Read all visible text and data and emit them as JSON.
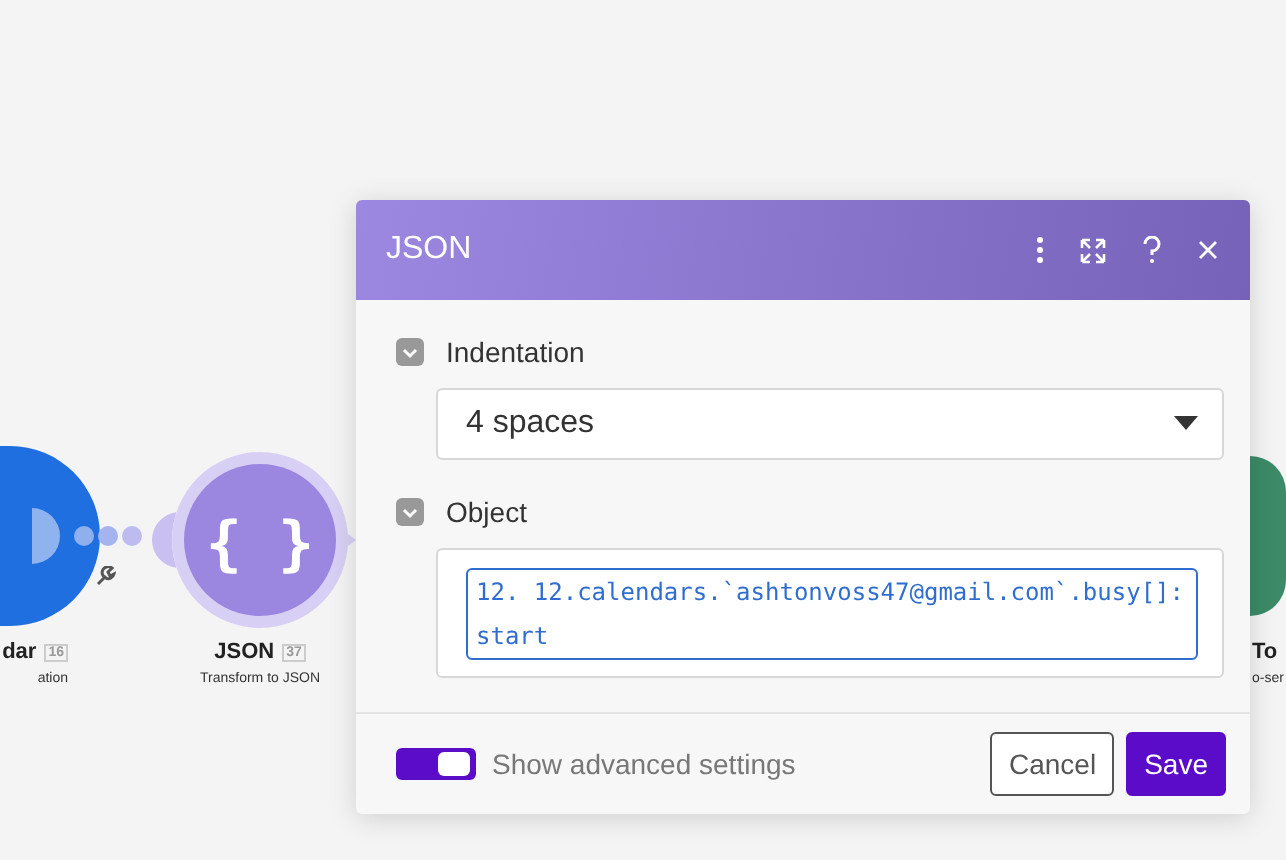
{
  "canvas": {
    "modules": [
      {
        "kind": "calendar",
        "name": "dar",
        "badge": "16",
        "subtitle": "ation"
      },
      {
        "kind": "json",
        "name": "JSON",
        "badge": "37",
        "subtitle": "Transform to JSON",
        "icon": "{ }"
      },
      {
        "kind": "tool",
        "name": "To",
        "subtitle": "o-ser"
      }
    ]
  },
  "dialog": {
    "title": "JSON",
    "fields": [
      {
        "kind": "select",
        "label": "Indentation",
        "value": "4 spaces"
      },
      {
        "kind": "mapping",
        "label": "Object",
        "token": "12. 12.calendars.`ashtonvoss47@gmail.com`.busy[]: start"
      }
    ],
    "advanced": {
      "label": "Show advanced settings",
      "on": true
    },
    "buttons": [
      {
        "kind": "secondary",
        "label": "Cancel"
      },
      {
        "kind": "primary",
        "label": "Save"
      }
    ]
  }
}
